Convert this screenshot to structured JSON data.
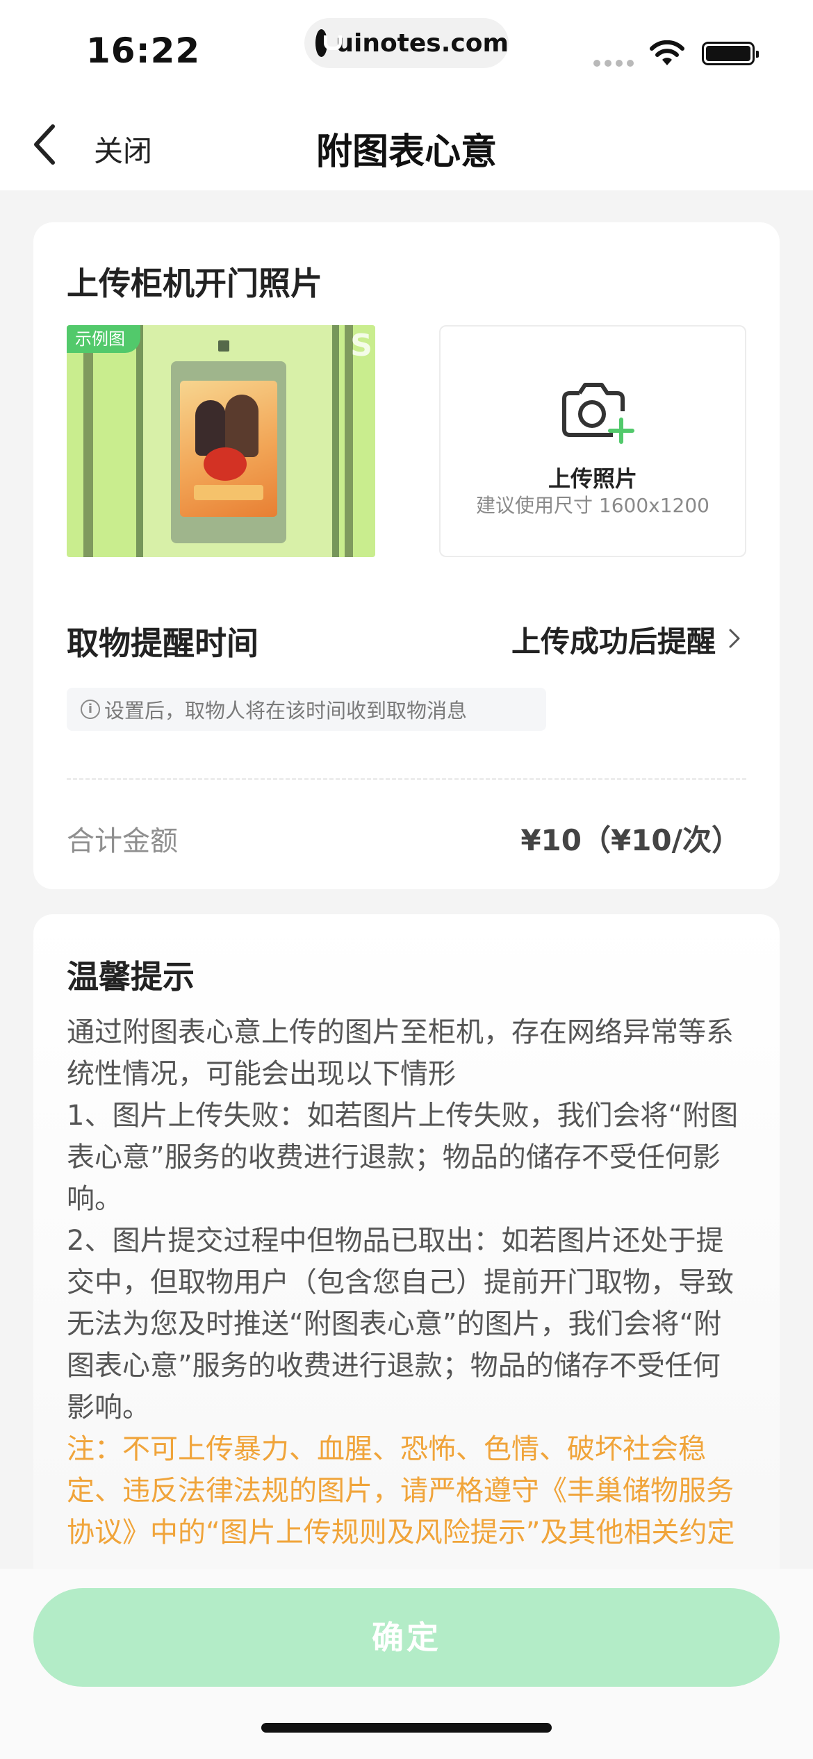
{
  "status_bar": {
    "time": "16:22",
    "url": "uinotes.com"
  },
  "nav": {
    "close_label": "关闭",
    "title": "附图表心意"
  },
  "upload_card": {
    "title": "上传柜机开门照片",
    "sample_badge": "示例图",
    "upload_label": "上传照片",
    "upload_hint": "建议使用尺寸 1600x1200",
    "remind_title": "取物提醒时间",
    "remind_value": "上传成功后提醒",
    "tip_text": "设置后，取物人将在该时间收到取物消息",
    "total_label": "合计金额",
    "total_value": "¥10（¥10/次）"
  },
  "notice": {
    "title": "温馨提示",
    "para1": "通过附图表心意上传的图片至柜机，存在网络异常等系统性情况，可能会出现以下情形",
    "para2": "1、图片上传失败：如若图片上传失败，我们会将“附图表心意”服务的收费进行退款；物品的储存不受任何影响。",
    "para3": "2、图片提交过程中但物品已取出：如若图片还处于提交中，但取物用户（包含您自己）提前开门取物，导致无法为您及时推送“附图表心意”的图片，我们会将“附图表心意”服务的收费进行退款；物品的储存不受任何影响。",
    "warning": "注：不可上传暴力、血腥、恐怖、色情、破坏社会稳定、违反法律法规的图片，请严格遵守《丰巢储物服务协议》中的“图片上传规则及风险提示”及其他相关约定"
  },
  "footer": {
    "confirm_label": "确定"
  },
  "colors": {
    "accent_green": "#52c96b",
    "button_disabled": "#b3ecc7",
    "warning_orange": "#f0a43a"
  },
  "icons": [
    "back-chevron-icon",
    "camera-plus-icon",
    "chevron-right-icon",
    "info-icon",
    "wifi-icon",
    "battery-icon"
  ]
}
